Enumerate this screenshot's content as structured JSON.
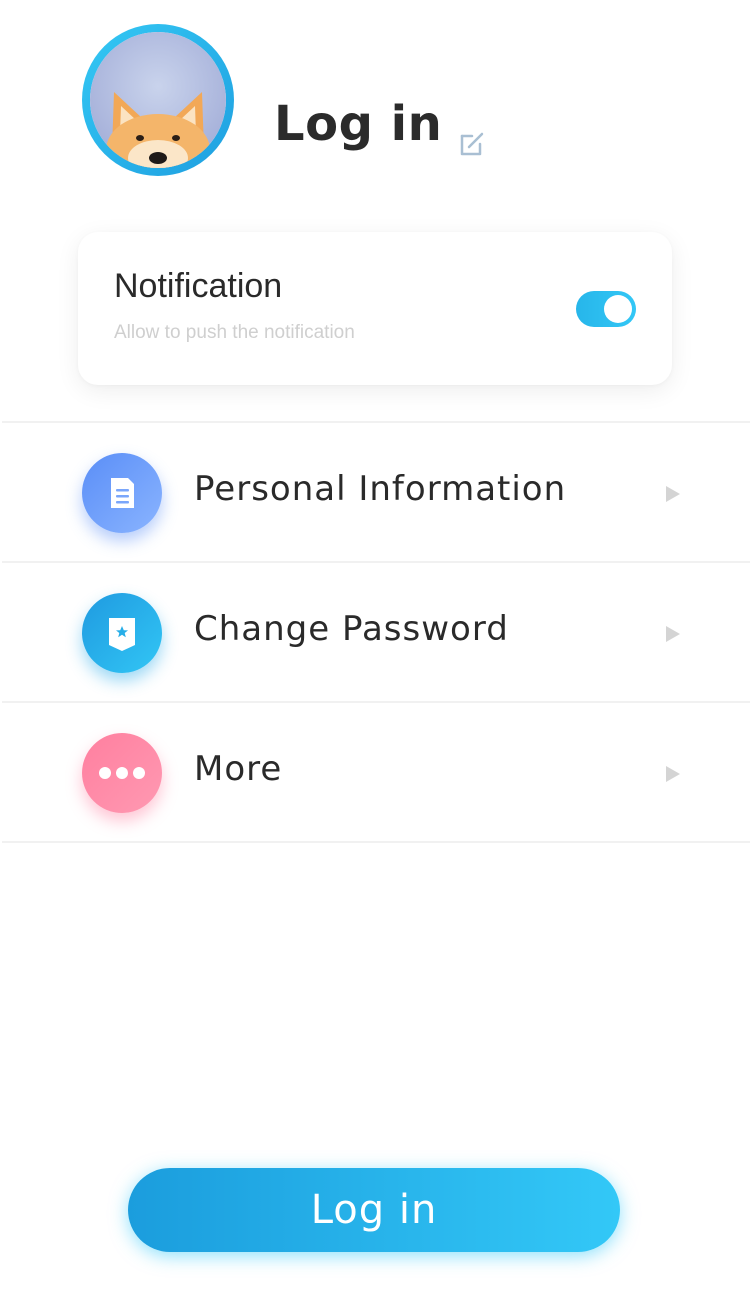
{
  "profile": {
    "title": "Log in",
    "avatar_icon": "fox-avatar",
    "edit_icon": "edit-icon"
  },
  "notification": {
    "title": "Notification",
    "subtitle": "Allow to push the notification",
    "toggle_on": true
  },
  "menu": {
    "items": [
      {
        "label": "Personal Information",
        "icon": "document-icon"
      },
      {
        "label": "Change Password",
        "icon": "shield-icon"
      },
      {
        "label": "More",
        "icon": "more-dots-icon"
      }
    ]
  },
  "login_button": {
    "label": "Log in"
  },
  "colors": {
    "accent": "#33c8f7",
    "accent_dark": "#1b9ddd",
    "doc_icon": "#5a8ef7",
    "more_icon": "#ff7f9f",
    "text": "#2a2a2a",
    "muted": "#cfcfcf"
  }
}
